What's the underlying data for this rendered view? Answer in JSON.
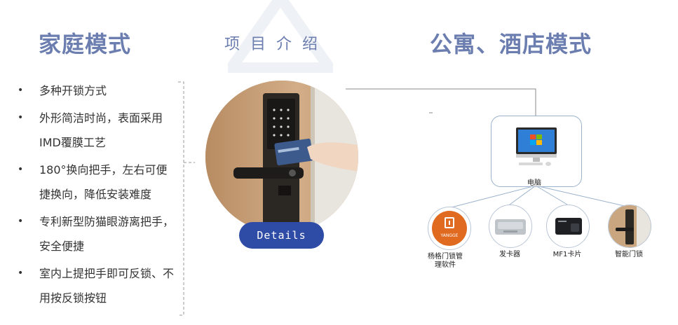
{
  "header": {
    "left_title": "家庭模式",
    "center_title": "项目介绍",
    "right_title": "公寓、酒店模式"
  },
  "features": [
    "多种开锁方式",
    "外形简洁时尚，表面采用IMD覆膜工艺",
    "180°换向把手，左右可便捷换向，降低安装难度",
    "专利新型防猫眼游离把手，安全便捷",
    "室内上提把手即可反锁、不用按反锁按钮"
  ],
  "details_button": {
    "label": "Details"
  },
  "diagram": {
    "center_node": {
      "label": "电脑",
      "icon": "computer-icon"
    },
    "nodes": [
      {
        "label": "杨格门锁管理软件",
        "icon": "yangge-software-icon",
        "logo_text": "YANGGE"
      },
      {
        "label": "发卡器",
        "icon": "card-issuer-icon"
      },
      {
        "label": "MF1卡片",
        "icon": "mf1-card-icon"
      },
      {
        "label": "智能门锁",
        "icon": "smart-lock-icon"
      }
    ]
  },
  "colors": {
    "title": "#6b7eaf",
    "button": "#2e4ba6",
    "connector": "#9ab2cc",
    "logo_orange": "#e06a1f"
  }
}
